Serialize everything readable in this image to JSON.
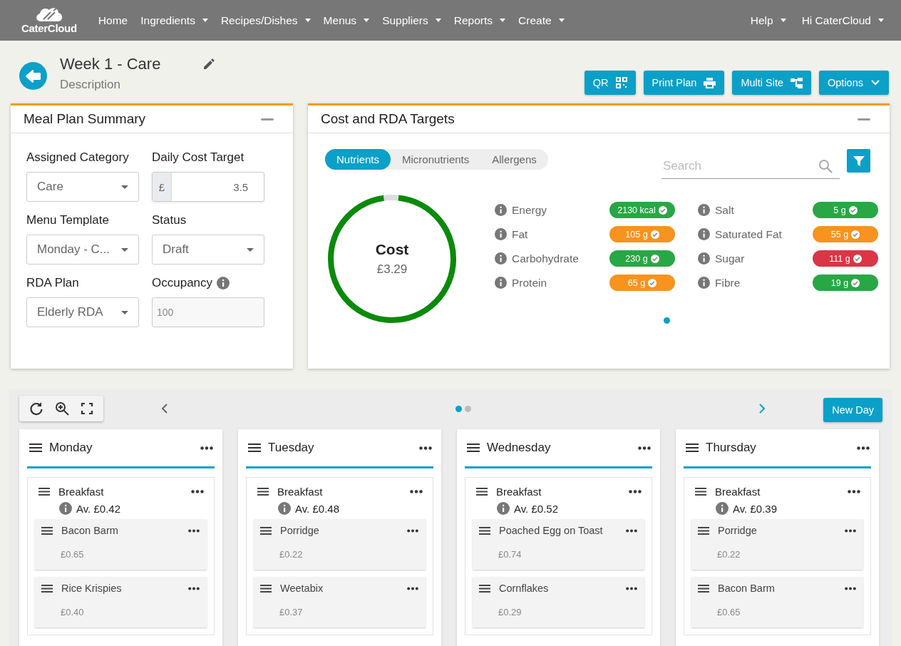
{
  "nav": {
    "logo": "CaterCloud",
    "items": [
      {
        "label": "Home",
        "dropdown": false
      },
      {
        "label": "Ingredients",
        "dropdown": true
      },
      {
        "label": "Recipes/Dishes",
        "dropdown": true
      },
      {
        "label": "Menus",
        "dropdown": true
      },
      {
        "label": "Suppliers",
        "dropdown": true
      },
      {
        "label": "Reports",
        "dropdown": true
      },
      {
        "label": "Create",
        "dropdown": true
      }
    ],
    "right": [
      {
        "label": "Help",
        "dropdown": true
      },
      {
        "label": "Hi CaterCloud",
        "dropdown": true
      }
    ]
  },
  "header": {
    "title": "Week 1 - Care",
    "description": "Description",
    "buttons": [
      {
        "label": "QR"
      },
      {
        "label": "Print Plan"
      },
      {
        "label": "Multi Site"
      },
      {
        "label": "Options"
      }
    ]
  },
  "summary": {
    "title": "Meal Plan Summary",
    "fields": [
      {
        "label": "Assigned Category",
        "kind": "select",
        "value": "Care",
        "info": false
      },
      {
        "label": "Daily Cost Target",
        "kind": "currency",
        "prefix": "£",
        "value": "3.5",
        "info": false
      },
      {
        "label": "Menu Template",
        "kind": "select",
        "value": "Monday - C...",
        "info": false
      },
      {
        "label": "Status",
        "kind": "select",
        "value": "Draft",
        "info": false
      },
      {
        "label": "RDA Plan",
        "kind": "select",
        "value": "Elderly RDA",
        "info": false
      },
      {
        "label": "Occupancy",
        "kind": "readonly",
        "value": "100",
        "info": true
      }
    ]
  },
  "targets": {
    "title": "Cost and RDA Targets",
    "tabs": [
      {
        "label": "Nutrients",
        "selected": true
      },
      {
        "label": "Micronutrients",
        "selected": false
      },
      {
        "label": "Allergens",
        "selected": false
      }
    ],
    "search": {
      "placeholder": "Search"
    },
    "cost": {
      "title": "Cost",
      "value": "£3.29",
      "level": 0.96
    },
    "nutrients": [
      {
        "name": "Energy",
        "value": "2130 kcal",
        "color": "#28a745"
      },
      {
        "name": "Fat",
        "value": "105 g",
        "color": "#f7931e"
      },
      {
        "name": "Carbohydrate",
        "value": "230 g",
        "color": "#28a745"
      },
      {
        "name": "Protein",
        "value": "65 g",
        "color": "#f7931e"
      },
      {
        "name": "Salt",
        "value": "5 g",
        "color": "#28a745"
      },
      {
        "name": "Saturated Fat",
        "value": "55 g",
        "color": "#f7931e"
      },
      {
        "name": "Sugar",
        "value": "111 g",
        "color": "#dc3545"
      },
      {
        "name": "Fibre",
        "value": "19 g",
        "color": "#28a745"
      }
    ],
    "pages": [
      {
        "selected": true
      }
    ]
  },
  "board": {
    "pages": [
      {
        "selected": true
      },
      {
        "selected": false
      }
    ],
    "new_day": "New Day",
    "days": [
      {
        "name": "Monday",
        "meals": [
          {
            "name": "Breakfast",
            "average": "Av. £0.42",
            "dishes": [
              {
                "name": "Bacon Barm",
                "price": "£0.65"
              },
              {
                "name": "Rice Krispies",
                "price": "£0.40"
              }
            ]
          }
        ]
      },
      {
        "name": "Tuesday",
        "meals": [
          {
            "name": "Breakfast",
            "average": "Av. £0.48",
            "dishes": [
              {
                "name": "Porridge",
                "price": "£0.22"
              },
              {
                "name": "Weetabix",
                "price": "£0.37"
              }
            ]
          }
        ]
      },
      {
        "name": "Wednesday",
        "meals": [
          {
            "name": "Breakfast",
            "average": "Av. £0.52",
            "dishes": [
              {
                "name": "Poached Egg on Toast",
                "price": "£0.74"
              },
              {
                "name": "Cornflakes",
                "price": "£0.29"
              }
            ]
          }
        ]
      },
      {
        "name": "Thursday",
        "meals": [
          {
            "name": "Breakfast",
            "average": "Av. £0.39",
            "dishes": [
              {
                "name": "Porridge",
                "price": "£0.22"
              },
              {
                "name": "Bacon Barm",
                "price": "£0.65"
              }
            ]
          }
        ]
      }
    ]
  }
}
